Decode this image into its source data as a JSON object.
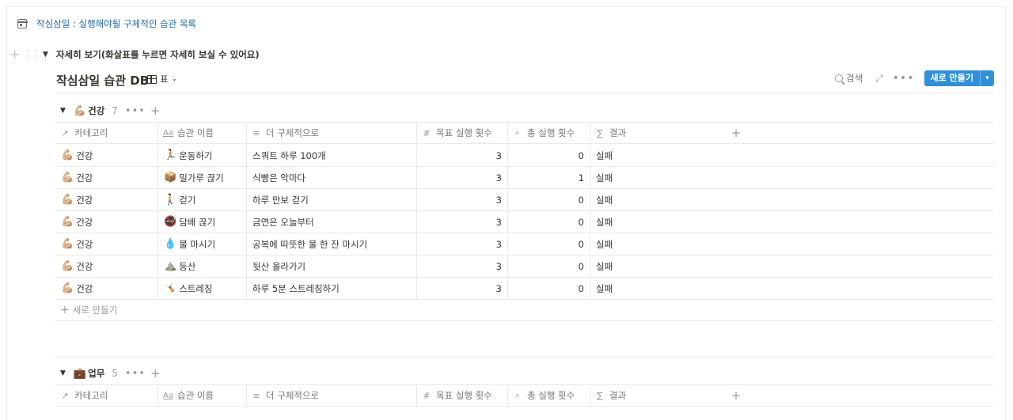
{
  "breadcrumb": {
    "icon": "calendar-icon",
    "label": "작심삼일 : 실행해야될 구체적인 습관 목록"
  },
  "toggle": {
    "label": "자세히 보기(화살표를 누르면 자세히 보실 수 있어요)"
  },
  "database": {
    "title": "작심삼일 습관 DB",
    "view_label": "표",
    "search_label": "검색",
    "new_button_label": "새로 만들기"
  },
  "columns": [
    "카테고리",
    "습관 이름",
    "더 구체적으로",
    "목표 실행 횟수",
    "총 실행 횟수",
    "결과"
  ],
  "groups": [
    {
      "emoji": "💪🏼",
      "label": "건강",
      "count": "7",
      "rows": [
        {
          "category": "건강",
          "habit_emoji": "🏃🏻",
          "habit": "운동하기",
          "detail": "스쿼트 하루 100개",
          "target": "3",
          "total": "0",
          "result": "실패"
        },
        {
          "category": "건강",
          "habit_emoji": "📦",
          "habit": "밀가루 끊기",
          "detail": "식빵은 악마다",
          "target": "3",
          "total": "1",
          "result": "실패"
        },
        {
          "category": "건강",
          "habit_emoji": "🚶🏻",
          "habit": "걷기",
          "detail": "하루 만보 걷기",
          "target": "3",
          "total": "0",
          "result": "실패"
        },
        {
          "category": "건강",
          "habit_emoji": "🚭",
          "habit": "담배 끊기",
          "detail": "금연은 오늘부터",
          "target": "3",
          "total": "0",
          "result": "실패"
        },
        {
          "category": "건강",
          "habit_emoji": "💧",
          "habit": "물 마시기",
          "detail": "공복에 따뜻한 물 한 잔 마시기",
          "target": "3",
          "total": "0",
          "result": "실패"
        },
        {
          "category": "건강",
          "habit_emoji": "⛰️",
          "habit": "등산",
          "detail": "뒷산 올라가기",
          "target": "3",
          "total": "0",
          "result": "실패"
        },
        {
          "category": "건강",
          "habit_emoji": "🤸🏻",
          "habit": "스트레칭",
          "detail": "하루 5분 스트레칭하기",
          "target": "3",
          "total": "0",
          "result": "실패"
        }
      ],
      "add_row_label": "새로 만들기"
    },
    {
      "emoji": "💼",
      "label": "업무",
      "count": "5"
    }
  ]
}
